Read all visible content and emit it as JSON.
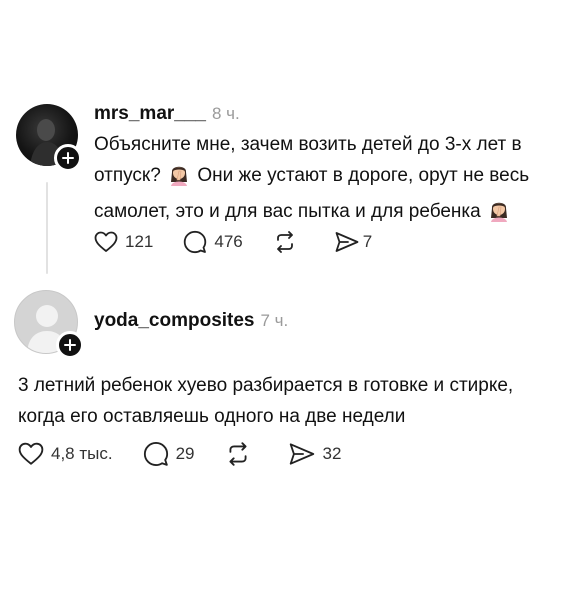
{
  "posts": [
    {
      "username": "mrs_mar___",
      "time": "8 ч.",
      "lines": [
        "Объясните мне, зачем возить детей до 3-х лет в",
        "отпуск?",
        "Они же устают в дороге, орут не весь",
        "самолет, это и для вас пытка и для ребенка"
      ],
      "likes": "121",
      "replies": "476",
      "reposts": "",
      "shares": "7"
    },
    {
      "username": "yoda_composites",
      "time": "7 ч.",
      "lines": [
        "3 летний ребенок хуево разбирается в готовке и стирке,",
        "когда его оставляешь одного на две недели"
      ],
      "likes": "4,8 тыс.",
      "replies": "29",
      "reposts": "",
      "shares": "32"
    }
  ],
  "icons": {
    "like": "heart-icon",
    "reply": "comment-icon",
    "repost": "repost-icon",
    "share": "send-icon",
    "follow": "plus-icon",
    "emoji": "facepalm-woman-emoji"
  },
  "colors": {
    "text": "#111111",
    "muted": "#9a9a9a",
    "line": "#e2e2e2"
  }
}
